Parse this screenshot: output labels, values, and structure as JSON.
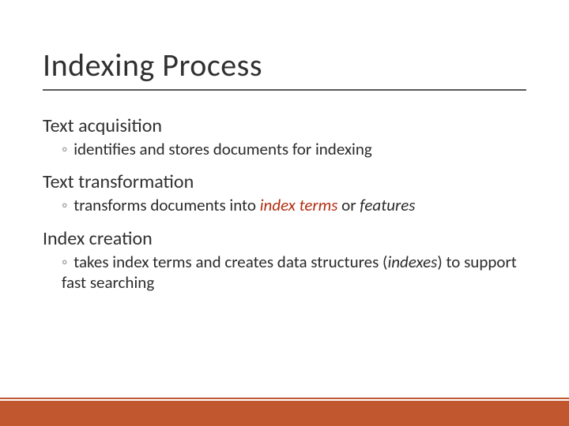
{
  "title": "Indexing Process",
  "sections": [
    {
      "heading": "Text acquisition",
      "bullet_prefix": "◦ ",
      "bullet_parts": [
        {
          "text": "identifies and stores documents for indexing",
          "style": "plain"
        }
      ]
    },
    {
      "heading": "Text transformation",
      "bullet_prefix": "◦ ",
      "bullet_parts": [
        {
          "text": "transforms documents into ",
          "style": "plain"
        },
        {
          "text": "index terms",
          "style": "red-italic"
        },
        {
          "text": " or ",
          "style": "plain"
        },
        {
          "text": "features",
          "style": "dark-italic"
        }
      ]
    },
    {
      "heading": "Index creation",
      "bullet_prefix": "◦ ",
      "bullet_parts": [
        {
          "text": "takes index terms and creates data structures (",
          "style": "plain"
        },
        {
          "text": "indexes",
          "style": "dark-italic"
        },
        {
          "text": ") to support fast searching",
          "style": "plain"
        }
      ]
    }
  ]
}
